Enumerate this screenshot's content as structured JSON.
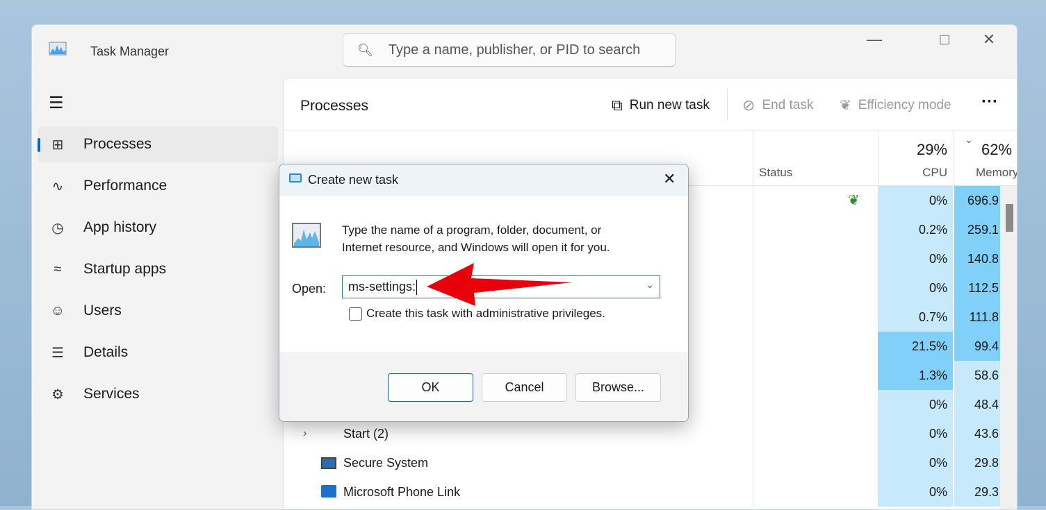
{
  "window": {
    "title": "Task Manager",
    "search_placeholder": "Type a name, publisher, or PID to search"
  },
  "sidebar": {
    "items": [
      {
        "label": "Processes",
        "icon": "processes-icon",
        "active": true
      },
      {
        "label": "Performance",
        "icon": "performance-icon"
      },
      {
        "label": "App history",
        "icon": "history-icon"
      },
      {
        "label": "Startup apps",
        "icon": "startup-icon"
      },
      {
        "label": "Users",
        "icon": "users-icon"
      },
      {
        "label": "Details",
        "icon": "details-icon"
      },
      {
        "label": "Services",
        "icon": "services-icon"
      }
    ]
  },
  "panel": {
    "title": "Processes",
    "run_new_task": "Run new task",
    "end_task": "End task",
    "efficiency_mode": "Efficiency mode"
  },
  "columns": {
    "status": "Status",
    "cpu_total": "29%",
    "cpu": "CPU",
    "mem_total": "62%",
    "memory": "Memory"
  },
  "rows": [
    {
      "name": "",
      "cpu": "0%",
      "mem": "696.9",
      "eco": true
    },
    {
      "name": "",
      "cpu": "0.2%",
      "mem": "259.1"
    },
    {
      "name": "",
      "cpu": "0%",
      "mem": "140.8"
    },
    {
      "name": "",
      "cpu": "0%",
      "mem": "112.5"
    },
    {
      "name": "",
      "cpu": "0.7%",
      "mem": "111.8"
    },
    {
      "name": "",
      "cpu": "21.5%",
      "mem": "99.4"
    },
    {
      "name": "",
      "cpu": "1.3%",
      "mem": "58.6"
    },
    {
      "name": "",
      "cpu": "0%",
      "mem": "48.4"
    },
    {
      "name": "Start (2)",
      "cpu": "0%",
      "mem": "43.6"
    },
    {
      "name": "Secure System",
      "cpu": "0%",
      "mem": "29.8"
    },
    {
      "name": "Microsoft Phone Link",
      "cpu": "0%",
      "mem": "29.3"
    }
  ],
  "dialog": {
    "title": "Create new task",
    "description_line1": "Type the name of a program, folder, document, or",
    "description_line2": "Internet resource, and Windows will open it for you.",
    "open_label": "Open:",
    "open_value": "ms-settings:",
    "admin_checkbox": "Create this task with administrative privileges.",
    "admin_checked": false,
    "ok": "OK",
    "cancel": "Cancel",
    "browse": "Browse..."
  },
  "colors": {
    "accent": "#0067c0",
    "cpu_light": "#c6e9fb",
    "heat": "#80d0fa",
    "annotation_arrow": "#e8000b"
  }
}
